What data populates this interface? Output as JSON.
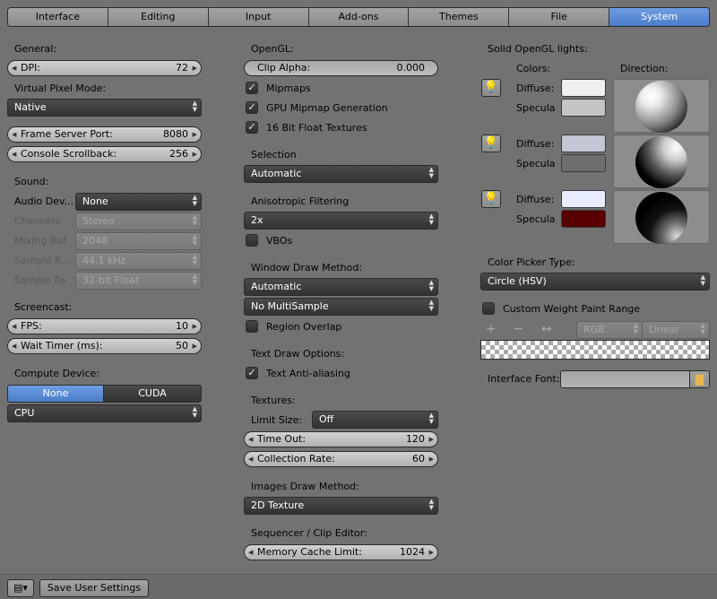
{
  "tabs": [
    {
      "label": "Interface",
      "active": false
    },
    {
      "label": "Editing",
      "active": false
    },
    {
      "label": "Input",
      "active": false
    },
    {
      "label": "Add-ons",
      "active": false
    },
    {
      "label": "Themes",
      "active": false
    },
    {
      "label": "File",
      "active": false
    },
    {
      "label": "System",
      "active": true
    }
  ],
  "left": {
    "general_label": "General:",
    "dpi": {
      "label": "DPI:",
      "value": "72"
    },
    "vpm_label": "Virtual Pixel Mode:",
    "vpm_value": "Native",
    "frame_server": {
      "label": "Frame Server Port:",
      "value": "8080"
    },
    "console": {
      "label": "Console Scrollback:",
      "value": "256"
    },
    "sound_label": "Sound:",
    "audio_device": {
      "label": "Audio Dev...",
      "value": "None"
    },
    "channels": {
      "label": "Channels:",
      "value": "Stereo"
    },
    "mixing": {
      "label": "Mixing Buf",
      "value": "2048"
    },
    "sample_rate": {
      "label": "Sample R...",
      "value": "44.1 kHz"
    },
    "sample_fmt": {
      "label": "Sample Fo",
      "value": "32-bit Float"
    },
    "screencast_label": "Screencast:",
    "fps": {
      "label": "FPS:",
      "value": "10"
    },
    "wait_timer": {
      "label": "Wait Timer (ms):",
      "value": "50"
    },
    "compute_label": "Compute Device:",
    "compute_none": "None",
    "compute_cuda": "CUDA",
    "compute_device_value": "CPU"
  },
  "middle": {
    "opengl_label": "OpenGL:",
    "clip_alpha": {
      "label": "Clip Alpha:",
      "value": "0.000"
    },
    "mipmaps": "Mipmaps",
    "gpu_mipmap": "GPU Mipmap Generation",
    "float_tex": "16 Bit Float Textures",
    "selection_label": "Selection",
    "selection_value": "Automatic",
    "aniso_label": "Anisotropic Filtering",
    "aniso_value": "2x",
    "vbos": "VBOs",
    "wdm_label": "Window Draw Method:",
    "wdm_value": "Automatic",
    "multisample_value": "No MultiSample",
    "region_overlap": "Region Overlap",
    "text_draw_label": "Text Draw Options:",
    "text_aa": "Text Anti-aliasing",
    "textures_label": "Textures:",
    "limit_size": {
      "label": "Limit Size:",
      "value": "Off"
    },
    "time_out": {
      "label": "Time Out:",
      "value": "120"
    },
    "collection_rate": {
      "label": "Collection Rate:",
      "value": "60"
    },
    "images_label": "Images Draw Method:",
    "images_value": "2D Texture",
    "seq_label": "Sequencer / Clip Editor:",
    "mem_cache": {
      "label": "Memory Cache Limit:",
      "value": "1024"
    }
  },
  "right": {
    "lights_label": "Solid OpenGL lights:",
    "colors_label": "Colors:",
    "direction_label": "Direction:",
    "diffuse_label": "Diffuse:",
    "specular_label": "Specula",
    "lights": [
      {
        "diffuse": "#efefef",
        "specular": "#c4c4c4"
      },
      {
        "diffuse": "#c4c6d6",
        "specular": "#6e6e6e"
      },
      {
        "diffuse": "#e8ecff",
        "specular": "#580000"
      }
    ],
    "picker_label": "Color Picker Type:",
    "picker_value": "Circle (HSV)",
    "custom_weight": "Custom Weight Paint Range",
    "ramp_plus": "+",
    "ramp_minus": "−",
    "ramp_flip": "↔",
    "ramp_mode": "RGB",
    "ramp_interp": "Linear",
    "font_label": "Interface Font:"
  },
  "bottom": {
    "save_label": "Save User Settings"
  }
}
